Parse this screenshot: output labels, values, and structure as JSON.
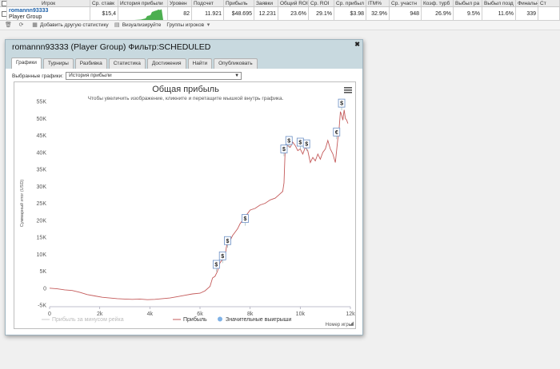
{
  "grid": {
    "headers": [
      "Игрок",
      "Ср. ставк",
      "История прибыли",
      "Уровен",
      "Подсчет",
      "Прибыль",
      "Заявки",
      "Общий ROI",
      "Ср. ROI",
      "Ср. прибыл",
      "ITM%",
      "Ср. участн",
      "Коэф. турб",
      "Выбыл ра",
      "Выбыл позд",
      "Финальн",
      "Ст"
    ],
    "row": {
      "player_name": "romannn93333",
      "player_group": "Player Group",
      "avg_stake": "$15,4",
      "level": "82",
      "count": "11.921",
      "profit": "$48.695",
      "entries": "12.231",
      "total_roi": "23.6%",
      "avg_roi": "29.1%",
      "avg_profit": "$3.98",
      "itm": "32.9%",
      "avg_entrants": "948",
      "turbo_ratio": "26.9%",
      "early_out": "9.5%",
      "late_out": "11.6%",
      "final": "339"
    }
  },
  "toolbar": {
    "add_stats": "Добавить другую статистику",
    "visualize": "Визуализируйте",
    "player_groups": "Группы игроков"
  },
  "window": {
    "title": "romannn93333 (Player Group) Фильтр:SCHEDULED",
    "tabs": [
      "Графики",
      "Турниры",
      "Разбивка",
      "Статистика",
      "Достижения",
      "Найти",
      "Опубликовать"
    ],
    "select_label": "Выбранные графики:",
    "select_value": "История прибыли"
  },
  "chart_data": {
    "type": "line",
    "title": "Общая прибыль",
    "subtitle": "Чтобы увеличить изображение, кликните и перетащите мышкой внутрь графика.",
    "xlabel": "Номер игры",
    "ylabel": "Суммарный итог (USD)",
    "xlim": [
      0,
      12000
    ],
    "ylim": [
      -5000,
      55000
    ],
    "x_ticks": [
      0,
      2000,
      4000,
      6000,
      8000,
      10000,
      12000
    ],
    "x_tick_labels": [
      "0",
      "2k",
      "4k",
      "6k",
      "8k",
      "10k",
      "12k"
    ],
    "y_ticks": [
      -5000,
      0,
      5000,
      10000,
      15000,
      20000,
      25000,
      30000,
      35000,
      40000,
      45000,
      50000,
      55000
    ],
    "y_tick_labels": [
      "-5K",
      "0",
      "5K",
      "10K",
      "15K",
      "20K",
      "25K",
      "30K",
      "35K",
      "40K",
      "45K",
      "50K",
      "55K"
    ],
    "grid": false,
    "legend_position": "bottom",
    "series": [
      {
        "name": "Прибыль за минусом рейка",
        "color": "#cccccc",
        "hidden": true,
        "x": [],
        "y": []
      },
      {
        "name": "Прибыль",
        "color": "#c45a5a",
        "x": [
          0,
          300,
          600,
          900,
          1200,
          1500,
          1800,
          2100,
          2400,
          2700,
          3000,
          3300,
          3600,
          3900,
          4200,
          4500,
          4800,
          5100,
          5400,
          5700,
          6000,
          6200,
          6400,
          6500,
          6600,
          6700,
          6750,
          6800,
          6900,
          7000,
          7050,
          7100,
          7200,
          7300,
          7400,
          7500,
          7600,
          7700,
          7800,
          7900,
          8000,
          8200,
          8400,
          8600,
          8800,
          9000,
          9150,
          9300,
          9350,
          9400,
          9500,
          9600,
          9700,
          9800,
          9900,
          10000,
          10100,
          10200,
          10300,
          10400,
          10500,
          10600,
          10700,
          10800,
          10900,
          11000,
          11100,
          11200,
          11300,
          11400,
          11500,
          11550,
          11600,
          11650,
          11700,
          11750,
          11800,
          11850,
          11900
        ],
        "y": [
          0,
          -200,
          -500,
          -700,
          -1200,
          -1900,
          -2300,
          -2700,
          -2900,
          -3100,
          -3200,
          -3300,
          -3200,
          -3400,
          -3300,
          -3100,
          -2900,
          -2500,
          -2100,
          -1700,
          -1500,
          -800,
          500,
          3000,
          3500,
          5000,
          6500,
          7500,
          8500,
          9000,
          12000,
          13500,
          14000,
          15500,
          16500,
          17500,
          19000,
          20000,
          21000,
          22000,
          23000,
          23500,
          24500,
          25000,
          26000,
          26500,
          27500,
          28500,
          31000,
          41000,
          42000,
          41500,
          43000,
          42000,
          40500,
          41000,
          39500,
          41500,
          40500,
          37000,
          38500,
          37500,
          39500,
          38000,
          40000,
          41000,
          43500,
          41000,
          39500,
          37000,
          44000,
          47000,
          52000,
          51000,
          49500,
          52500,
          50000,
          49500,
          48500
        ]
      }
    ],
    "markers": [
      {
        "label": "$",
        "x": 6650,
        "y": 7000
      },
      {
        "label": "$",
        "x": 6900,
        "y": 9500
      },
      {
        "label": "$",
        "x": 7100,
        "y": 14000
      },
      {
        "label": "$",
        "x": 7800,
        "y": 20500
      },
      {
        "label": "$",
        "x": 9350,
        "y": 41000
      },
      {
        "label": "$",
        "x": 9550,
        "y": 43500
      },
      {
        "label": "$",
        "x": 10000,
        "y": 43000
      },
      {
        "label": "$",
        "x": 10250,
        "y": 42500
      },
      {
        "label": "€",
        "x": 11450,
        "y": 46000
      },
      {
        "label": "$",
        "x": 11650,
        "y": 54500
      }
    ],
    "legend": [
      "Прибыль за минусом рейка",
      "Прибыль",
      "Значительные выигрыши"
    ]
  }
}
